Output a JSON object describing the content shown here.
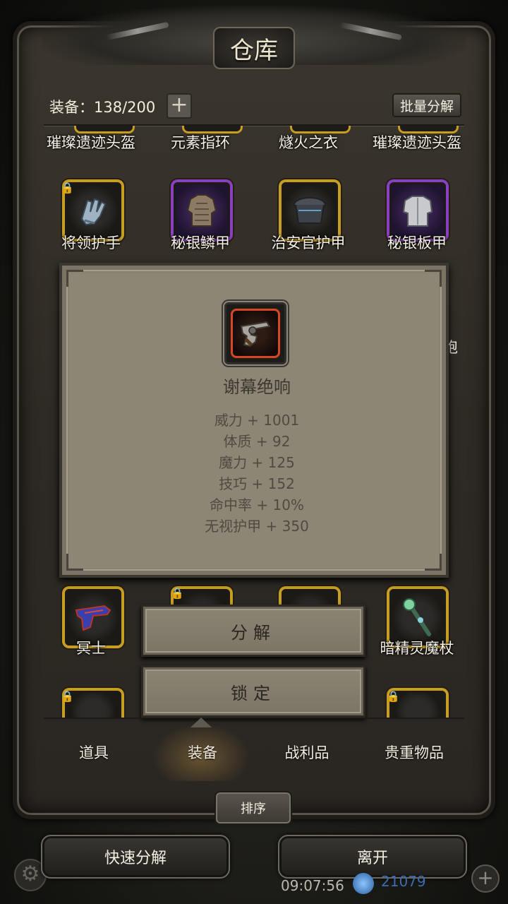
{
  "window": {
    "title": "仓库"
  },
  "header": {
    "equipment_label": "装备：138/200",
    "plus_icon": "+",
    "batch_disassemble": "批量分解"
  },
  "grid": {
    "row1": [
      {
        "name": "璀璨遗迹头盔"
      },
      {
        "name": "元素指环"
      },
      {
        "name": "燧火之衣"
      },
      {
        "name": "璀璨遗迹头盔"
      }
    ],
    "row2": [
      {
        "name": "将领护手",
        "rarity": "gold",
        "locked": true,
        "icon": "gauntlet-icon"
      },
      {
        "name": "秘银鳞甲",
        "rarity": "purple",
        "locked": false,
        "icon": "scale-armor-icon"
      },
      {
        "name": "治安官护甲",
        "rarity": "gold",
        "locked": false,
        "icon": "officer-armor-icon"
      },
      {
        "name": "秘银板甲",
        "rarity": "purple",
        "locked": false,
        "icon": "plate-armor-icon"
      }
    ],
    "partial_right_text": "袍",
    "row4": [
      {
        "name": "冥士",
        "rarity": "gold",
        "locked": false,
        "icon": "pistol-icon"
      },
      {
        "name": "",
        "rarity": "gold",
        "locked": true,
        "icon": "item-icon"
      },
      {
        "name": "",
        "rarity": "gold",
        "locked": false,
        "icon": "item-icon"
      },
      {
        "name": "暗精灵魔杖",
        "rarity": "gold",
        "locked": false,
        "icon": "staff-icon"
      }
    ]
  },
  "tooltip": {
    "item_name": "谢幕绝响",
    "icon": "revolver-icon",
    "rarity_color": "#d84623",
    "stats": [
      "威力 + 1001",
      "体质 + 92",
      "魔力 + 125",
      "技巧 + 152",
      "命中率 + 10%",
      "无视护甲 + 350"
    ]
  },
  "actions": {
    "disassemble": "分解",
    "lock": "锁定"
  },
  "tabs": [
    {
      "label": "道具",
      "active": false
    },
    {
      "label": "装备",
      "active": true
    },
    {
      "label": "战利品",
      "active": false
    },
    {
      "label": "贵重物品",
      "active": false
    }
  ],
  "sort_button": "排序",
  "bottom": {
    "quick_disassemble": "快速分解",
    "leave": "离开",
    "clock": "09:07:56",
    "gems": "21079"
  },
  "colors": {
    "gold_frame": "#c79d24",
    "purple_frame": "#8b3fc0",
    "red_frame": "#d33c1e",
    "panel": "#8a8271"
  }
}
